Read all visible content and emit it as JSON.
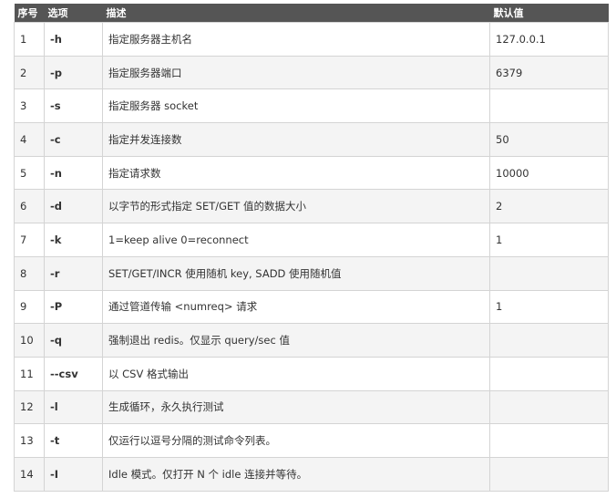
{
  "table": {
    "headers": {
      "no": "序号",
      "option": "选项",
      "description": "描述",
      "default": "默认值"
    },
    "rows": [
      {
        "no": "1",
        "option": "-h",
        "description": "指定服务器主机名",
        "default": "127.0.0.1"
      },
      {
        "no": "2",
        "option": "-p",
        "description": "指定服务器端口",
        "default": "6379"
      },
      {
        "no": "3",
        "option": "-s",
        "description": "指定服务器 socket",
        "default": ""
      },
      {
        "no": "4",
        "option": "-c",
        "description": "指定并发连接数",
        "default": "50"
      },
      {
        "no": "5",
        "option": "-n",
        "description": "指定请求数",
        "default": "10000"
      },
      {
        "no": "6",
        "option": "-d",
        "description": "以字节的形式指定 SET/GET 值的数据大小",
        "default": "2"
      },
      {
        "no": "7",
        "option": "-k",
        "description": "1=keep alive 0=reconnect",
        "default": "1"
      },
      {
        "no": "8",
        "option": "-r",
        "description": "SET/GET/INCR 使用随机 key, SADD 使用随机值",
        "default": ""
      },
      {
        "no": "9",
        "option": "-P",
        "description": "通过管道传输 <numreq> 请求",
        "default": "1"
      },
      {
        "no": "10",
        "option": "-q",
        "description": "强制退出 redis。仅显示 query/sec 值",
        "default": ""
      },
      {
        "no": "11",
        "option": "--csv",
        "description": "以 CSV 格式输出",
        "default": ""
      },
      {
        "no": "12",
        "option": "-l",
        "description": "生成循环，永久执行测试",
        "default": ""
      },
      {
        "no": "13",
        "option": "-t",
        "description": "仅运行以逗号分隔的测试命令列表。",
        "default": ""
      },
      {
        "no": "14",
        "option": "-I",
        "description": "Idle 模式。仅打开 N 个 idle 连接并等待。",
        "default": ""
      }
    ]
  },
  "colors": {
    "header_bg": "#555555",
    "header_text": "#ffffff",
    "row_alt_bg": "#f4f4f4",
    "border": "#d4d4d4"
  }
}
